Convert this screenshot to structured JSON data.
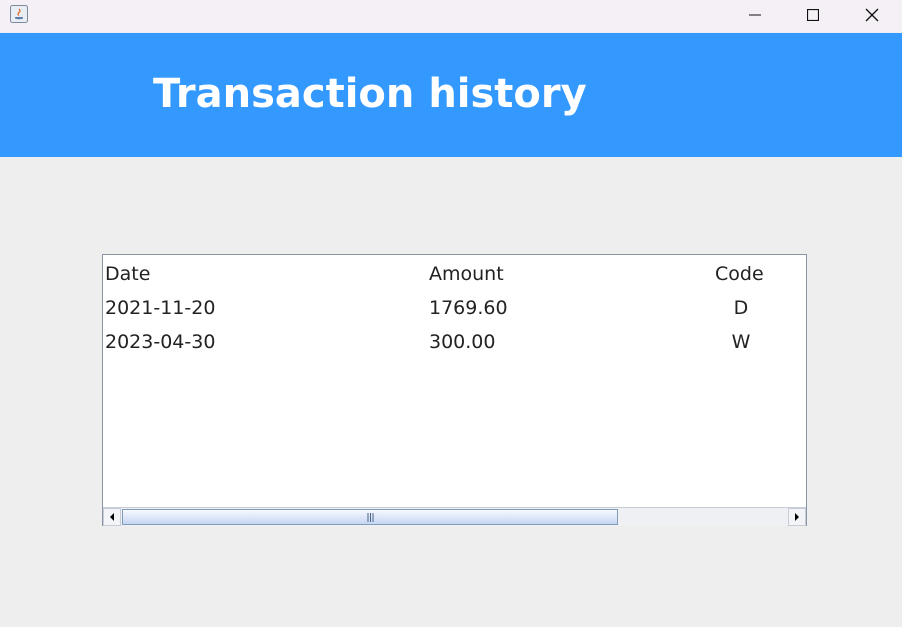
{
  "header": {
    "title": "Transaction history"
  },
  "table": {
    "columns": [
      "Date",
      "Amount",
      "Code"
    ],
    "rows": [
      [
        "2021-11-20",
        "1769.60",
        "D"
      ],
      [
        "2023-04-30",
        "300.00",
        "W"
      ]
    ]
  },
  "colors": {
    "header_background": "#3399ff",
    "window_background": "#eeeeee",
    "table_background": "#ffffff"
  }
}
